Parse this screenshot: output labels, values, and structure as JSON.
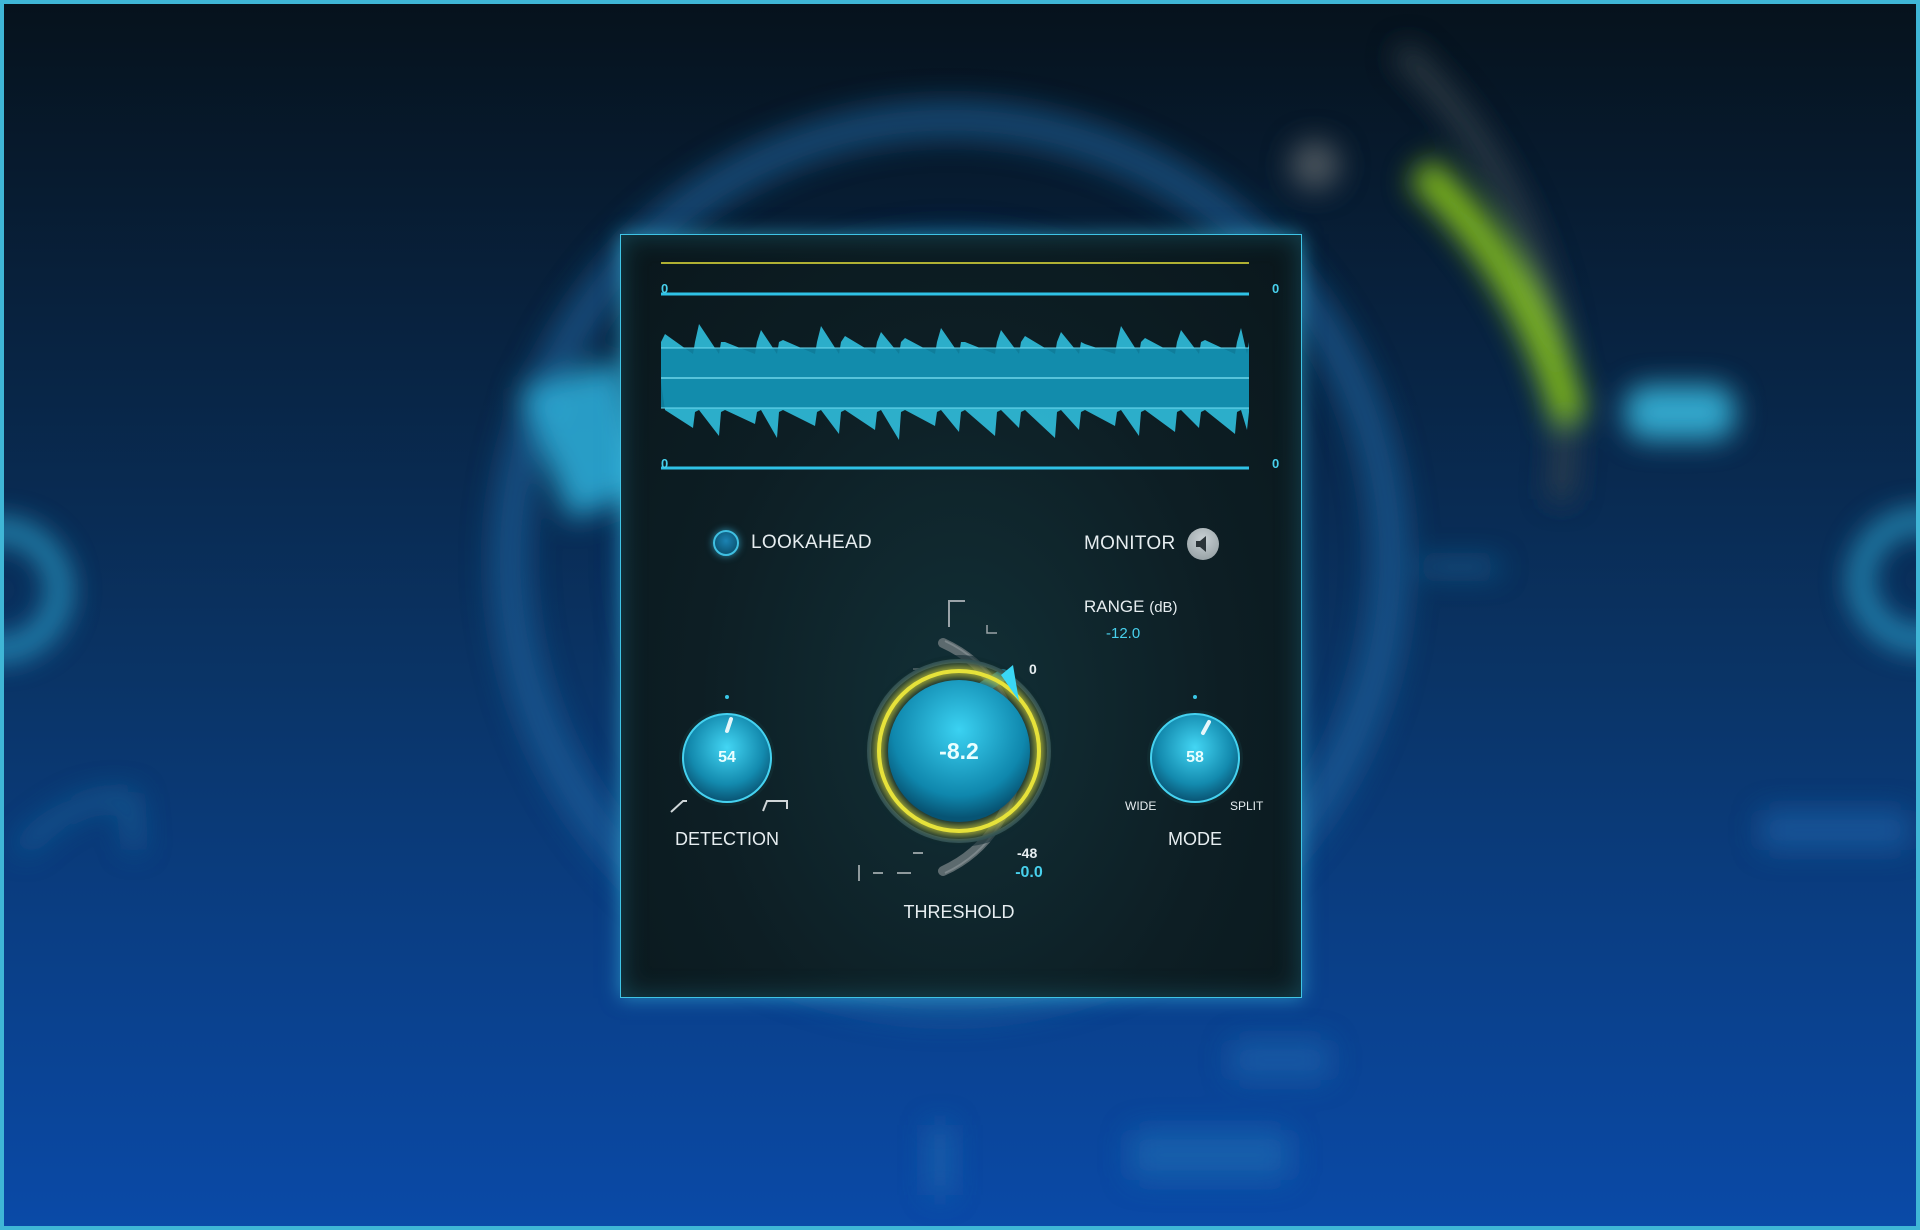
{
  "waveform": {
    "top_left_tick": "0",
    "top_right_tick": "0",
    "bottom_left_tick": "0",
    "bottom_right_tick": "0",
    "colors": {
      "wave": "#33c8e8",
      "band": "#0f88a8",
      "limit_line": "#e6e23a"
    }
  },
  "lookahead": {
    "label": "LOOKAHEAD",
    "enabled": true
  },
  "monitor": {
    "label": "MONITOR",
    "icon": "speaker-icon"
  },
  "range": {
    "title": "RANGE",
    "unit": "(dB)",
    "value": "-12.0"
  },
  "threshold": {
    "label": "THRESHOLD",
    "value": "-8.2",
    "scale_top": "0",
    "scale_bottom": "-48",
    "readout": "-0.0",
    "ring_color": "#e6e23a"
  },
  "detection": {
    "label": "DETECTION",
    "value": "54"
  },
  "mode": {
    "label": "MODE",
    "value": "58",
    "left_label": "WIDE",
    "right_label": "SPLIT"
  },
  "colors": {
    "accent": "#3fc4e6",
    "text": "#e6edf0"
  }
}
